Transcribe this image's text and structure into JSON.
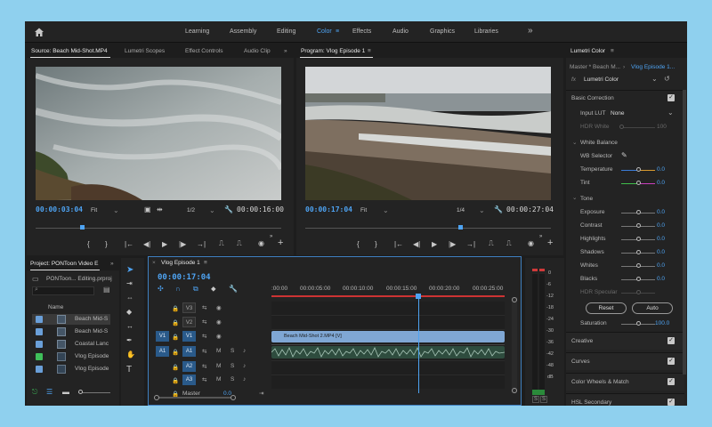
{
  "workspaces": {
    "items": [
      "Learning",
      "Assembly",
      "Editing",
      "Color",
      "Effects",
      "Audio",
      "Graphics",
      "Libraries"
    ],
    "active": "Color",
    "more": "»"
  },
  "source": {
    "tabs": [
      "Source: Beach Mid-Shot.MP4",
      "Lumetri Scopes",
      "Effect Controls",
      "Audio Clip"
    ],
    "overflow": "»",
    "timecode": "00:00:03:04",
    "fit": "Fit",
    "resolution": "1/2",
    "duration": "00:00:16:00",
    "playhead_fraction": 0.19
  },
  "program": {
    "title": "Program: Vlog Episode 1",
    "menu": "≡",
    "timecode": "00:00:17:04",
    "fit": "Fit",
    "resolution": "1/4",
    "duration": "00:00:27:04",
    "playhead_fraction": 0.63
  },
  "transport": {
    "mark_in": "{",
    "mark_out": "}",
    "go_in": "|←",
    "step_back": "◀|",
    "play": "▶",
    "step_fwd": "|▶",
    "go_out": "→|",
    "add": "+"
  },
  "lumetri": {
    "title": "Lumetri Color",
    "menu": "≡",
    "master_clip": "Master * Beach M...",
    "sequence_clip": "Vlog Episode 1...",
    "fx_label": "fx",
    "effect_name": "Lumetri Color",
    "basic_correction": "Basic Correction",
    "input_lut_label": "Input LUT",
    "input_lut_value": "None",
    "hdr_white_label": "HDR White",
    "hdr_white_value": "100",
    "white_balance": "White Balance",
    "wb_selector": "WB Selector",
    "temperature_label": "Temperature",
    "temperature_value": "0.0",
    "tint_label": "Tint",
    "tint_value": "0.0",
    "tone": "Tone",
    "sliders": [
      {
        "label": "Exposure",
        "value": "0.0"
      },
      {
        "label": "Contrast",
        "value": "0.0"
      },
      {
        "label": "Highlights",
        "value": "0.0"
      },
      {
        "label": "Shadows",
        "value": "0.0"
      },
      {
        "label": "Whites",
        "value": "0.0"
      },
      {
        "label": "Blacks",
        "value": "0.0"
      }
    ],
    "hdr_specular_label": "HDR Specular",
    "reset": "Reset",
    "auto": "Auto",
    "saturation_label": "Saturation",
    "saturation_value": "100.0",
    "sections": [
      "Creative",
      "Curves",
      "Color Wheels & Match",
      "HSL Secondary"
    ]
  },
  "project": {
    "title": "Project: PONToon Video E",
    "overflow": "»",
    "file": "PONToon... Editing.prproj",
    "name_header": "Name",
    "items": [
      {
        "name": "Beach Mid-S",
        "color": "#6a9fd8"
      },
      {
        "name": "Beach Mid-S",
        "color": "#6a9fd8"
      },
      {
        "name": "Coastal Lanc",
        "color": "#6a9fd8"
      },
      {
        "name": "Vlog Episode",
        "color": "#3fbf5a"
      },
      {
        "name": "Vlog Episode",
        "color": "#6a9fd8"
      }
    ]
  },
  "timeline": {
    "title": "Vlog Episode 1",
    "menu": "≡",
    "timecode": "00:00:17:04",
    "ruler": [
      ":00:00",
      "00:00:05:00",
      "00:00:10:00",
      "00:00:15:00",
      "00:00:20:00",
      "00:00:25:00"
    ],
    "tracks": [
      {
        "id": "V3",
        "src": ""
      },
      {
        "id": "V2",
        "src": ""
      },
      {
        "id": "V1",
        "src": "V1"
      },
      {
        "id": "A1",
        "src": "A1"
      },
      {
        "id": "A2",
        "src": ""
      },
      {
        "id": "A3",
        "src": ""
      }
    ],
    "master_label": "Master",
    "master_value": "0.0",
    "video_clip": "Beach Mid-Shot 2.MP4 [V]",
    "playhead_fraction": 0.63
  },
  "meter": {
    "labels": [
      "0",
      "-6",
      "-12",
      "-18",
      "-24",
      "-30",
      "-36",
      "-42",
      "-48",
      "dB"
    ],
    "solo": [
      "S",
      "S"
    ]
  }
}
